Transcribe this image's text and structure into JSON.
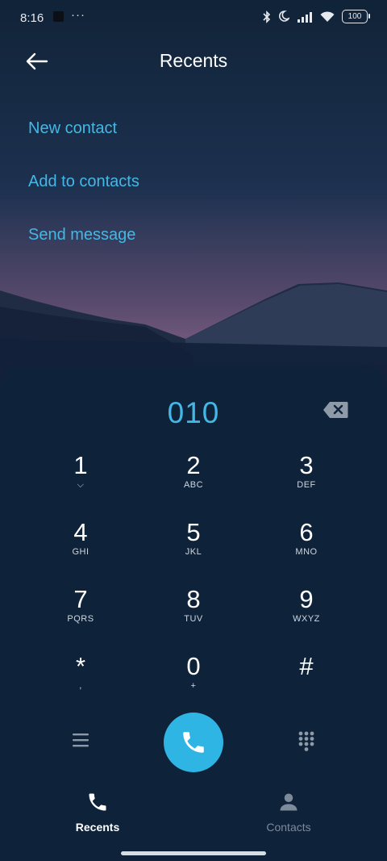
{
  "status_bar": {
    "time": "8:16",
    "dots": "···",
    "battery": "100"
  },
  "header": {
    "title": "Recents"
  },
  "actions": [
    "New contact",
    "Add to contacts",
    "Send message"
  ],
  "dialer": {
    "number": "010",
    "keys": [
      {
        "digit": "1",
        "letters": "⌵"
      },
      {
        "digit": "2",
        "letters": "ABC"
      },
      {
        "digit": "3",
        "letters": "DEF"
      },
      {
        "digit": "4",
        "letters": "GHI"
      },
      {
        "digit": "5",
        "letters": "JKL"
      },
      {
        "digit": "6",
        "letters": "MNO"
      },
      {
        "digit": "7",
        "letters": "PQRS"
      },
      {
        "digit": "8",
        "letters": "TUV"
      },
      {
        "digit": "9",
        "letters": "WXYZ"
      },
      {
        "digit": "*",
        "letters": ","
      },
      {
        "digit": "0",
        "letters": "+"
      },
      {
        "digit": "#",
        "letters": ""
      }
    ]
  },
  "tabs": {
    "recents": "Recents",
    "contacts": "Contacts"
  },
  "colors": {
    "accent": "#43b8e6",
    "call_button": "#2fb5e4",
    "panel": "#0e2239"
  }
}
